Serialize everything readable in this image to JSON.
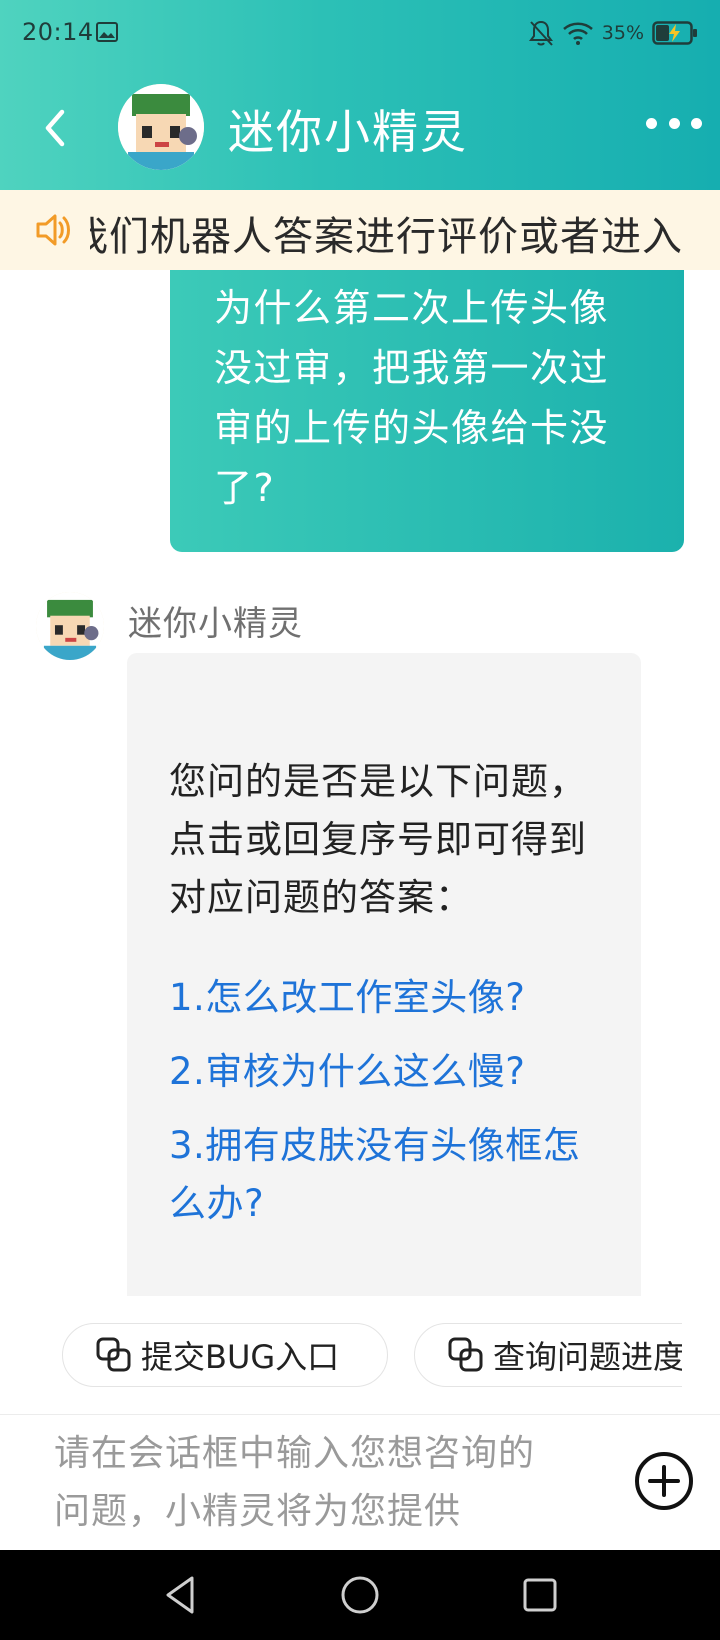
{
  "status_bar": {
    "time": "20:14",
    "battery": "35%",
    "icons": [
      "gallery-icon",
      "mute-bell-icon",
      "wifi-icon",
      "battery-charging-icon"
    ]
  },
  "header": {
    "title": "迷你小精灵",
    "back_icon": "chevron-left-icon",
    "more_icon": "more-dots-icon",
    "accent_gradient": [
      "#4fd3bf",
      "#16aeb0"
    ]
  },
  "notice": {
    "icon": "speaker-icon",
    "text": "我们机器人答案进行评价或者进入"
  },
  "messages": {
    "user": {
      "text": "为什么第二次上传头像没过审，把我第一次过审的上传的头像给卡没了?"
    },
    "bot": {
      "name": "迷你小精灵",
      "intro": "您问的是否是以下问题，点击或回复序号即可得到对应问题的答案：",
      "options": [
        "1.怎么改工作室头像?",
        "2.审核为什么这么慢?",
        "3.拥有皮肤没有头像框怎么办?"
      ],
      "link_color": "#1e73d8"
    }
  },
  "quick_actions": [
    {
      "label": "提交BUG入口",
      "icon": "link-icon"
    },
    {
      "label": "查询问题进度",
      "icon": "link-icon"
    }
  ],
  "input": {
    "placeholder": "请在会话框中输入您想咨询的问题，小精灵将为您提供",
    "add_icon": "plus-circle-icon"
  },
  "nav_bar": {
    "buttons": [
      "back-triangle-icon",
      "home-circle-icon",
      "recents-square-icon"
    ]
  }
}
